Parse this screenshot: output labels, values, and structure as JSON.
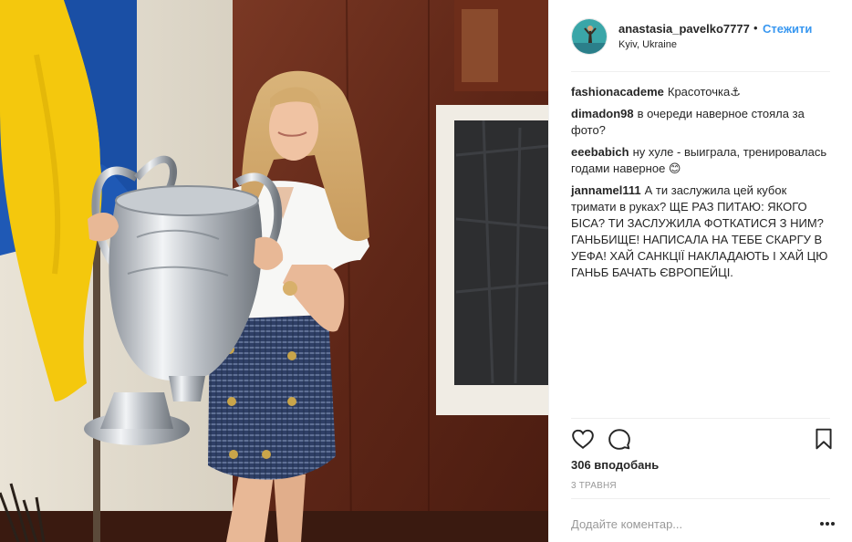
{
  "post": {
    "header": {
      "username": "anastasia_pavelko7777",
      "separator": "•",
      "follow_label": "Стежити",
      "location": "Kyiv, Ukraine"
    },
    "comments": [
      {
        "author": "fashionacademe",
        "text": "Красоточка⚓"
      },
      {
        "author": "dimadon98",
        "text": "в очереди наверное стояла за фото?"
      },
      {
        "author": "eeebabich",
        "text": "ну хуле - выиграла, тренировалась годами наверное 😊"
      },
      {
        "author": "jannamel111",
        "text": "А ти заслужила цей кубок тримати в руках? ЩЕ РАЗ ПИТАЮ: ЯКОГО БІСА? ТИ ЗАСЛУЖИЛА ФОТКАТИСЯ З НИМ? ГАНЬБИЩЕ! НАПИСАЛА НА ТЕБЕ СКАРГУ В УЕФА! ХАЙ САНКЦІЇ НАКЛАДАЮТЬ І ХАЙ ЦЮ ГАНЬБ БАЧАТЬ ЄВРОПЕЙЦІ."
      }
    ],
    "actions": {
      "like_icon": "heart-outline-icon",
      "comment_icon": "speech-bubble-icon",
      "save_icon": "bookmark-icon"
    },
    "likes": "306 вподобань",
    "date": "3 ТРАВНЯ",
    "add_comment_placeholder": "Додайте коментар...",
    "more_icon": "ellipsis-icon"
  },
  "colors": {
    "link": "#3897f0",
    "text": "#262626",
    "muted": "#999999",
    "border": "#efefef"
  }
}
